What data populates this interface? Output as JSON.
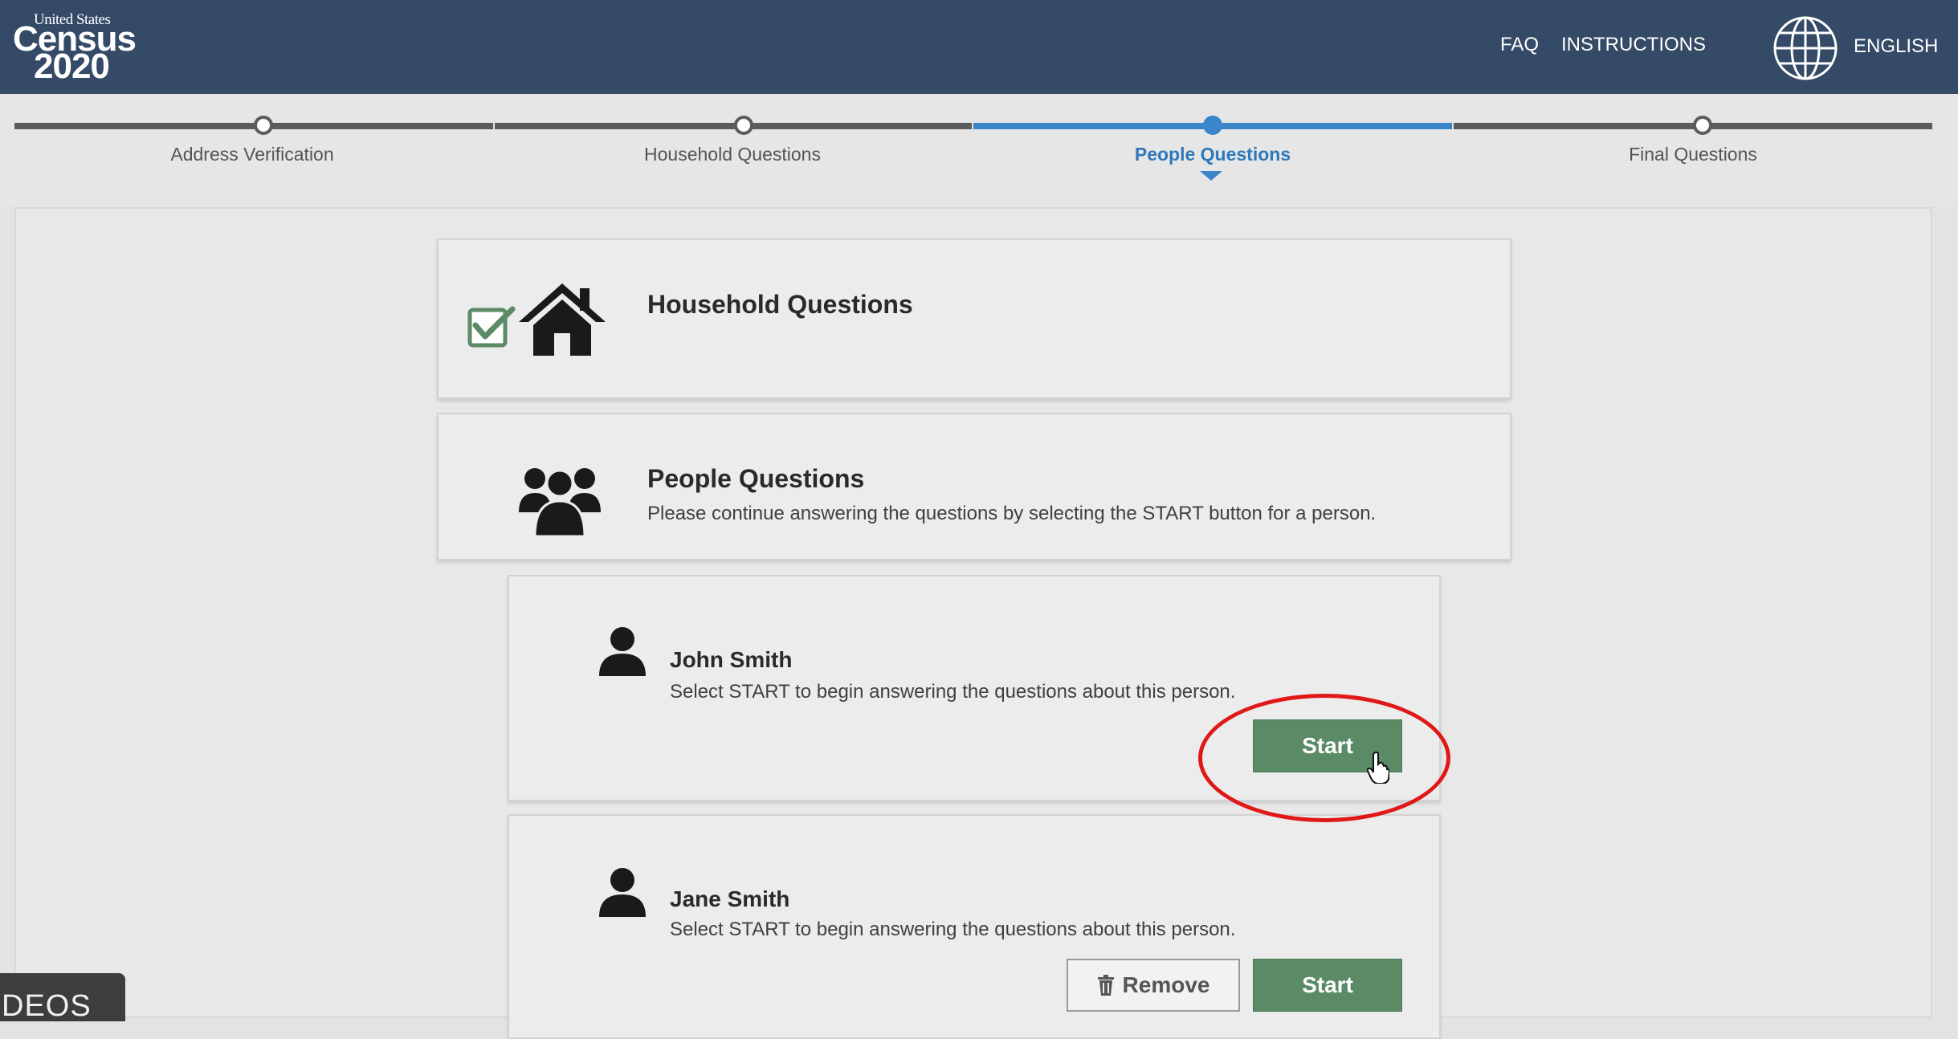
{
  "logo": {
    "united_states": "United States",
    "census": "Census",
    "year": "2020"
  },
  "header": {
    "faq": "FAQ",
    "instructions": "INSTRUCTIONS",
    "language": "ENGLISH"
  },
  "steps": [
    {
      "label": "Address Verification",
      "active": false
    },
    {
      "label": "Household Questions",
      "active": false
    },
    {
      "label": "People Questions",
      "active": true
    },
    {
      "label": "Final Questions",
      "active": false
    }
  ],
  "household_card": {
    "title": "Household Questions",
    "completed": true
  },
  "people_card": {
    "title": "People Questions",
    "subtitle": "Please continue answering the questions by selecting the START button for a person."
  },
  "persons": [
    {
      "name": "John Smith",
      "description": "Select START to begin answering the questions about this person.",
      "start_label": "Start"
    },
    {
      "name": "Jane Smith",
      "description": "Select START to begin answering the questions about this person.",
      "remove_label": "Remove",
      "start_label": "Start"
    }
  ],
  "corner_badge": "DEOS",
  "colors": {
    "header_bg": "#344a66",
    "active_step": "#3a86c8",
    "start_button": "#5a8a66",
    "highlight_ring": "#e01818",
    "checkmark": "#5a8a66"
  }
}
